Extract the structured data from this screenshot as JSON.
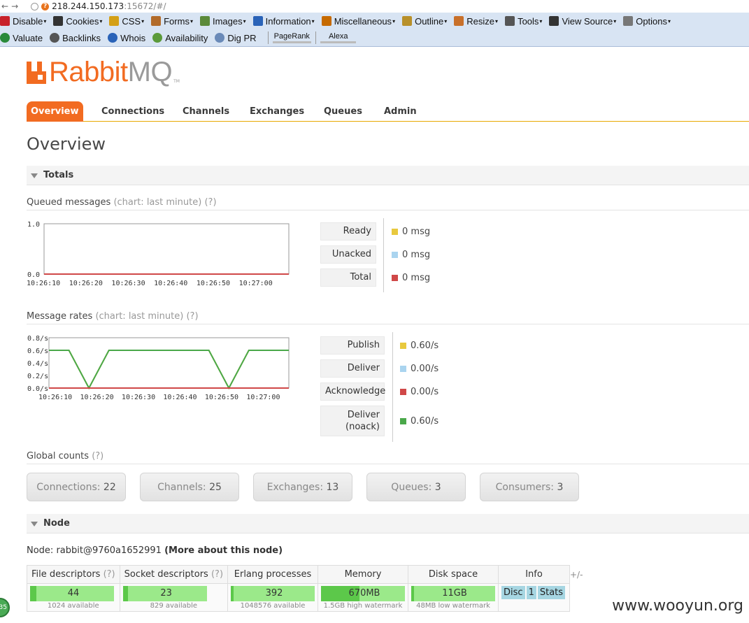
{
  "browser": {
    "url_host": "218.244.150.173",
    "url_path": ":15672/#/"
  },
  "devbar": {
    "row1": [
      "Disable",
      "Cookies",
      "CSS",
      "Forms",
      "Images",
      "Information",
      "Miscellaneous",
      "Outline",
      "Resize",
      "Tools",
      "View Source",
      "Options"
    ],
    "row2": [
      "Valuate",
      "Backlinks",
      "Whois",
      "Availability",
      "Dig PR"
    ],
    "pagerank": "PageRank",
    "alexa": "Alexa"
  },
  "logo": {
    "rabbit": "Rabbit",
    "mq": "MQ",
    "tm": "TM"
  },
  "tabs": [
    "Overview",
    "Connections",
    "Channels",
    "Exchanges",
    "Queues",
    "Admin"
  ],
  "page_title": "Overview",
  "totals": {
    "heading": "Totals",
    "queued": {
      "label": "Queued messages",
      "chart_note": "(chart: last minute)",
      "help": "(?)",
      "legend": [
        {
          "label": "Ready",
          "value": "0 msg",
          "color": "#e8c93e"
        },
        {
          "label": "Unacked",
          "value": "0 msg",
          "color": "#aad4ef"
        },
        {
          "label": "Total",
          "value": "0 msg",
          "color": "#d04848"
        }
      ]
    },
    "rates": {
      "label": "Message rates",
      "chart_note": "(chart: last minute)",
      "help": "(?)",
      "legend": [
        {
          "label": "Publish",
          "value": "0.60/s",
          "color": "#e8c93e"
        },
        {
          "label": "Deliver",
          "value": "0.00/s",
          "color": "#aad4ef"
        },
        {
          "label": "Acknowledge",
          "value": "0.00/s",
          "color": "#d04848"
        },
        {
          "label": "Deliver (noack)",
          "value": "0.60/s",
          "color": "#4aa84a"
        }
      ]
    },
    "global_counts": {
      "label": "Global counts",
      "help": "(?)",
      "items": [
        {
          "label": "Connections:",
          "value": "22"
        },
        {
          "label": "Channels:",
          "value": "25"
        },
        {
          "label": "Exchanges:",
          "value": "13"
        },
        {
          "label": "Queues:",
          "value": "3"
        },
        {
          "label": "Consumers:",
          "value": "3"
        }
      ]
    }
  },
  "node": {
    "heading": "Node",
    "prefix": "Node: rabbit@9760a1652991",
    "more": "(More about this node)",
    "columns": [
      {
        "label": "File descriptors",
        "help": "(?)"
      },
      {
        "label": "Socket descriptors",
        "help": "(?)"
      },
      {
        "label": "Erlang processes",
        "help": ""
      },
      {
        "label": "Memory",
        "help": ""
      },
      {
        "label": "Disk space",
        "help": ""
      },
      {
        "label": "Info",
        "help": ""
      }
    ],
    "cells": [
      {
        "value": "44",
        "sub": "1024 available",
        "fraction": 0.043
      },
      {
        "value": "23",
        "sub": "829 available",
        "fraction": 0.028
      },
      {
        "value": "392",
        "sub": "1048576 available",
        "fraction": 0.0004
      },
      {
        "value": "670MB",
        "sub": "1.5GB high watermark",
        "fraction": 0.44
      },
      {
        "value": "11GB",
        "sub": "48MB low watermark",
        "fraction": 0.0
      }
    ],
    "info_badges": [
      "Disc",
      "1",
      "Stats"
    ],
    "plus_minus": "+/-"
  },
  "watermark": "www.wooyun.org",
  "corner_badge": "35",
  "chart_data": [
    {
      "type": "line",
      "title": "Queued messages",
      "x": [
        "10:26:10",
        "10:26:20",
        "10:26:30",
        "10:26:40",
        "10:26:50",
        "10:27:00"
      ],
      "ylim": [
        0,
        1.0
      ],
      "yticks": [
        "0.0",
        "1.0"
      ],
      "series": [
        {
          "name": "Ready",
          "color": "#e8c93e",
          "values": [
            0,
            0,
            0,
            0,
            0,
            0,
            0
          ]
        },
        {
          "name": "Unacked",
          "color": "#aad4ef",
          "values": [
            0,
            0,
            0,
            0,
            0,
            0,
            0
          ]
        },
        {
          "name": "Total",
          "color": "#d04848",
          "values": [
            0,
            0,
            0,
            0,
            0,
            0,
            0
          ]
        }
      ]
    },
    {
      "type": "line",
      "title": "Message rates",
      "x": [
        "10:26:10",
        "10:26:20",
        "10:26:30",
        "10:26:40",
        "10:26:50",
        "10:27:00"
      ],
      "ylim": [
        0,
        0.8
      ],
      "yticks": [
        "0.0/s",
        "0.2/s",
        "0.4/s",
        "0.6/s",
        "0.8/s"
      ],
      "series": [
        {
          "name": "Publish",
          "color": "#e8c93e",
          "points": [
            [
              0,
              0.6
            ],
            [
              5,
              0.6
            ],
            [
              10,
              0
            ],
            [
              15,
              0.6
            ],
            [
              40,
              0.6
            ],
            [
              45,
              0
            ],
            [
              50,
              0.6
            ],
            [
              60,
              0.6
            ]
          ]
        },
        {
          "name": "Deliver (noack)",
          "color": "#4aa84a",
          "points": [
            [
              0,
              0.6
            ],
            [
              5,
              0.6
            ],
            [
              10,
              0
            ],
            [
              15,
              0.6
            ],
            [
              40,
              0.6
            ],
            [
              45,
              0
            ],
            [
              50,
              0.6
            ],
            [
              60,
              0.6
            ]
          ]
        },
        {
          "name": "Acknowledge",
          "color": "#d04848",
          "points": [
            [
              0,
              0
            ],
            [
              60,
              0
            ]
          ]
        }
      ]
    }
  ]
}
